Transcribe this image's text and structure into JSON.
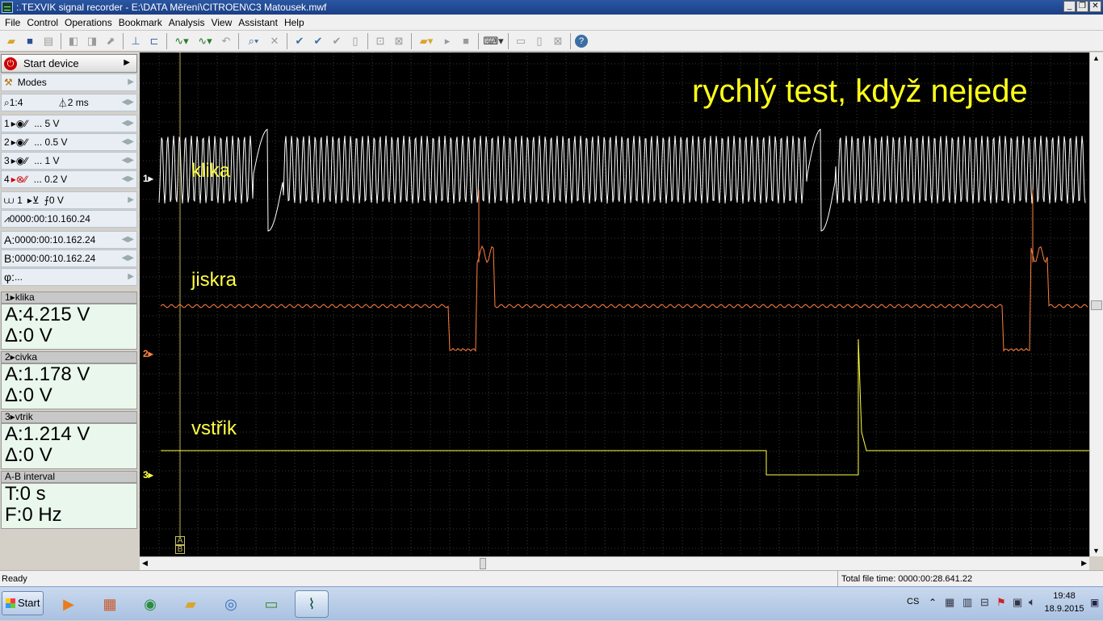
{
  "window": {
    "title": ":.TEXVIK  signal recorder - E:\\DATA Měření\\CITROEN\\C3 Matousek.mwf",
    "min_label": "_",
    "restore_label": "❐",
    "close_label": "✕"
  },
  "menu": [
    "File",
    "Control",
    "Operations",
    "Bookmark",
    "Analysis",
    "View",
    "Assistant",
    "Help"
  ],
  "panel": {
    "start_label": "Start device",
    "modes_label": "Modes",
    "zoom": "1:4",
    "timebase": "2 ms",
    "channels": [
      {
        "num": "1",
        "volts": "... 5 V"
      },
      {
        "num": "2",
        "volts": "... 0.5 V"
      },
      {
        "num": "3",
        "volts": "... 1 V"
      },
      {
        "num": "4",
        "volts": "... 0.2 V"
      }
    ],
    "trigger_channel": "1",
    "trigger_level": "0 V",
    "trigger_time": "0000:00:10.160.24",
    "cursor_a": "0000:00:10.162.24",
    "cursor_b": "0000:00:10.162.24",
    "phi": "...",
    "cursor_a_label": "A:",
    "cursor_b_label": "B:",
    "phi_label": "φ:"
  },
  "measurements": [
    {
      "title": "1▸klika",
      "a": "A:4.215 V",
      "d": "Δ:0 V"
    },
    {
      "title": "2▸civka",
      "a": "A:1.178 V",
      "d": "Δ:0 V"
    },
    {
      "title": "3▸vtrik",
      "a": "A:1.214 V",
      "d": "Δ:0 V"
    }
  ],
  "interval": {
    "title": "A-B interval",
    "t": "T:0 s",
    "f": "F:0 Hz"
  },
  "scope": {
    "annotation": "rychlý test, když nejede",
    "label_ch1": "klika",
    "label_ch2": "jiskra",
    "label_ch3": "vstřik",
    "marker1": "1▸",
    "marker2": "2▸",
    "marker3": "3▸",
    "cursor_a": "A",
    "cursor_b": "B",
    "colors": {
      "ch1": "#ffffff",
      "ch2": "#ff8040",
      "ch3": "#ffff40",
      "grid": "#3a3a3a"
    }
  },
  "status": {
    "left": "Ready",
    "right": "Total file time: 0000:00:28.641.22"
  },
  "taskbar": {
    "start_label": "Start",
    "lang": "CS",
    "time": "19:48",
    "date": "18.9.2015"
  }
}
